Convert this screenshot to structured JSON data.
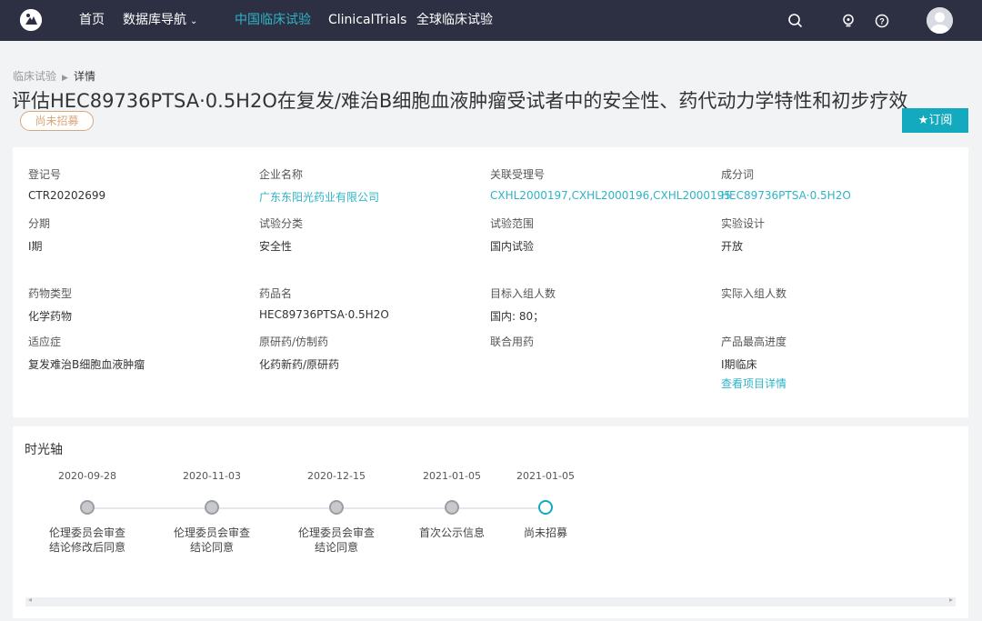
{
  "nav": {
    "items": [
      {
        "label": "首页"
      },
      {
        "label": "数据库导航"
      },
      {
        "label": "中国临床试验"
      },
      {
        "label": "ClinicalTrials"
      },
      {
        "label": "全球临床试验"
      }
    ],
    "active_index": 2,
    "icons": [
      "search-icon",
      "lightbulb-icon",
      "help-icon"
    ],
    "accent_color": "#2fb3c7",
    "bar_color": "#2d3042"
  },
  "breadcrumb": {
    "parent": "临床试验",
    "current": "详情"
  },
  "title": "评估HEC89736PTSA·0.5H2O在复发/难治B细胞血液肿瘤受试者中的安全性、药代动力学特性和初步疗效",
  "status_badge": "尚未招募",
  "subscribe_label": "★订阅",
  "fields": {
    "reg_no": {
      "label": "登记号",
      "value": "CTR20202699"
    },
    "company": {
      "label": "企业名称",
      "value": "广东东阳光药业有限公司"
    },
    "acceptance_no": {
      "label": "关联受理号",
      "value": "CXHL2000197,CXHL2000196,CXHL2000195"
    },
    "ingredient": {
      "label": "成分词",
      "value": "HEC89736PTSA·0.5H2O"
    },
    "phase": {
      "label": "分期",
      "value": "I期"
    },
    "trial_category": {
      "label": "试验分类",
      "value": "安全性"
    },
    "trial_scope": {
      "label": "试验范围",
      "value": "国内试验"
    },
    "design": {
      "label": "实验设计",
      "value": "开放"
    },
    "drug_type": {
      "label": "药物类型",
      "value": "化学药物"
    },
    "drug_name": {
      "label": "药品名",
      "value": "HEC89736PTSA·0.5H2O"
    },
    "target_enroll": {
      "label": "目标入组人数",
      "value": "国内: 80；"
    },
    "actual_enroll": {
      "label": "实际入组人数",
      "value": ""
    },
    "indication": {
      "label": "适应症",
      "value": "复发难治B细胞血液肿瘤"
    },
    "origin": {
      "label": "原研药/仿制药",
      "value": "化药新药/原研药"
    },
    "combination": {
      "label": "联合用药",
      "value": ""
    },
    "max_progress": {
      "label": "产品最高进度",
      "value": "I期临床",
      "link": "查看项目详情"
    }
  },
  "timeline": {
    "title": "时光轴",
    "items": [
      {
        "date": "2020-09-28",
        "label1": "伦理委员会审查",
        "label2": "结论修改后同意",
        "current": false
      },
      {
        "date": "2020-11-03",
        "label1": "伦理委员会审查",
        "label2": "结论同意",
        "current": false
      },
      {
        "date": "2020-12-15",
        "label1": "伦理委员会审查",
        "label2": "结论同意",
        "current": false
      },
      {
        "date": "2021-01-05",
        "label1": "首次公示信息",
        "label2": "",
        "current": false
      },
      {
        "date": "2021-01-05",
        "label1": "尚未招募",
        "label2": "",
        "current": true
      }
    ]
  }
}
